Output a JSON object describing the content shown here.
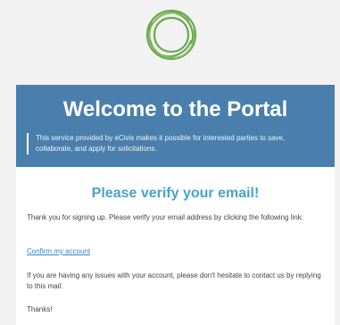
{
  "logo": {
    "icon": "ecivis-ring-logo",
    "color": "#6aa84f"
  },
  "hero": {
    "title": "Welcome to the Portal",
    "description": "This service provided by eCivis makes it possible for interested parties to save, collaborate, and apply for solicitations.",
    "background": "#4a7fad"
  },
  "card": {
    "heading": "Please verify your email!",
    "intro": "Thank you for signing up. Please verify your email address by clicking the following link:",
    "confirm_link": "Confirm my account",
    "help": "If you are having any issues with your account, please don't hesitate to contact us by replying to this mail.",
    "closing": "Thanks!",
    "heading_color": "#4aa3c6",
    "link_color": "#3b84c4"
  }
}
